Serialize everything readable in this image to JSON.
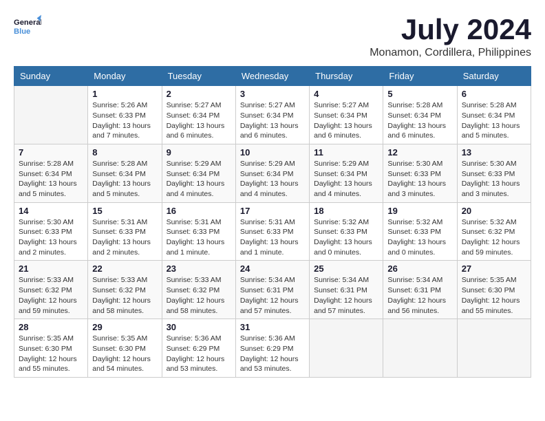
{
  "header": {
    "logo_general": "General",
    "logo_blue": "Blue",
    "month_year": "July 2024",
    "location": "Monamon, Cordillera, Philippines"
  },
  "weekdays": [
    "Sunday",
    "Monday",
    "Tuesday",
    "Wednesday",
    "Thursday",
    "Friday",
    "Saturday"
  ],
  "weeks": [
    [
      {
        "day": "",
        "info": ""
      },
      {
        "day": "1",
        "info": "Sunrise: 5:26 AM\nSunset: 6:33 PM\nDaylight: 13 hours\nand 7 minutes."
      },
      {
        "day": "2",
        "info": "Sunrise: 5:27 AM\nSunset: 6:34 PM\nDaylight: 13 hours\nand 6 minutes."
      },
      {
        "day": "3",
        "info": "Sunrise: 5:27 AM\nSunset: 6:34 PM\nDaylight: 13 hours\nand 6 minutes."
      },
      {
        "day": "4",
        "info": "Sunrise: 5:27 AM\nSunset: 6:34 PM\nDaylight: 13 hours\nand 6 minutes."
      },
      {
        "day": "5",
        "info": "Sunrise: 5:28 AM\nSunset: 6:34 PM\nDaylight: 13 hours\nand 6 minutes."
      },
      {
        "day": "6",
        "info": "Sunrise: 5:28 AM\nSunset: 6:34 PM\nDaylight: 13 hours\nand 5 minutes."
      }
    ],
    [
      {
        "day": "7",
        "info": "Sunrise: 5:28 AM\nSunset: 6:34 PM\nDaylight: 13 hours\nand 5 minutes."
      },
      {
        "day": "8",
        "info": "Sunrise: 5:28 AM\nSunset: 6:34 PM\nDaylight: 13 hours\nand 5 minutes."
      },
      {
        "day": "9",
        "info": "Sunrise: 5:29 AM\nSunset: 6:34 PM\nDaylight: 13 hours\nand 4 minutes."
      },
      {
        "day": "10",
        "info": "Sunrise: 5:29 AM\nSunset: 6:34 PM\nDaylight: 13 hours\nand 4 minutes."
      },
      {
        "day": "11",
        "info": "Sunrise: 5:29 AM\nSunset: 6:34 PM\nDaylight: 13 hours\nand 4 minutes."
      },
      {
        "day": "12",
        "info": "Sunrise: 5:30 AM\nSunset: 6:33 PM\nDaylight: 13 hours\nand 3 minutes."
      },
      {
        "day": "13",
        "info": "Sunrise: 5:30 AM\nSunset: 6:33 PM\nDaylight: 13 hours\nand 3 minutes."
      }
    ],
    [
      {
        "day": "14",
        "info": "Sunrise: 5:30 AM\nSunset: 6:33 PM\nDaylight: 13 hours\nand 2 minutes."
      },
      {
        "day": "15",
        "info": "Sunrise: 5:31 AM\nSunset: 6:33 PM\nDaylight: 13 hours\nand 2 minutes."
      },
      {
        "day": "16",
        "info": "Sunrise: 5:31 AM\nSunset: 6:33 PM\nDaylight: 13 hours\nand 1 minute."
      },
      {
        "day": "17",
        "info": "Sunrise: 5:31 AM\nSunset: 6:33 PM\nDaylight: 13 hours\nand 1 minute."
      },
      {
        "day": "18",
        "info": "Sunrise: 5:32 AM\nSunset: 6:33 PM\nDaylight: 13 hours\nand 0 minutes."
      },
      {
        "day": "19",
        "info": "Sunrise: 5:32 AM\nSunset: 6:33 PM\nDaylight: 13 hours\nand 0 minutes."
      },
      {
        "day": "20",
        "info": "Sunrise: 5:32 AM\nSunset: 6:32 PM\nDaylight: 12 hours\nand 59 minutes."
      }
    ],
    [
      {
        "day": "21",
        "info": "Sunrise: 5:33 AM\nSunset: 6:32 PM\nDaylight: 12 hours\nand 59 minutes."
      },
      {
        "day": "22",
        "info": "Sunrise: 5:33 AM\nSunset: 6:32 PM\nDaylight: 12 hours\nand 58 minutes."
      },
      {
        "day": "23",
        "info": "Sunrise: 5:33 AM\nSunset: 6:32 PM\nDaylight: 12 hours\nand 58 minutes."
      },
      {
        "day": "24",
        "info": "Sunrise: 5:34 AM\nSunset: 6:31 PM\nDaylight: 12 hours\nand 57 minutes."
      },
      {
        "day": "25",
        "info": "Sunrise: 5:34 AM\nSunset: 6:31 PM\nDaylight: 12 hours\nand 57 minutes."
      },
      {
        "day": "26",
        "info": "Sunrise: 5:34 AM\nSunset: 6:31 PM\nDaylight: 12 hours\nand 56 minutes."
      },
      {
        "day": "27",
        "info": "Sunrise: 5:35 AM\nSunset: 6:30 PM\nDaylight: 12 hours\nand 55 minutes."
      }
    ],
    [
      {
        "day": "28",
        "info": "Sunrise: 5:35 AM\nSunset: 6:30 PM\nDaylight: 12 hours\nand 55 minutes."
      },
      {
        "day": "29",
        "info": "Sunrise: 5:35 AM\nSunset: 6:30 PM\nDaylight: 12 hours\nand 54 minutes."
      },
      {
        "day": "30",
        "info": "Sunrise: 5:36 AM\nSunset: 6:29 PM\nDaylight: 12 hours\nand 53 minutes."
      },
      {
        "day": "31",
        "info": "Sunrise: 5:36 AM\nSunset: 6:29 PM\nDaylight: 12 hours\nand 53 minutes."
      },
      {
        "day": "",
        "info": ""
      },
      {
        "day": "",
        "info": ""
      },
      {
        "day": "",
        "info": ""
      }
    ]
  ]
}
